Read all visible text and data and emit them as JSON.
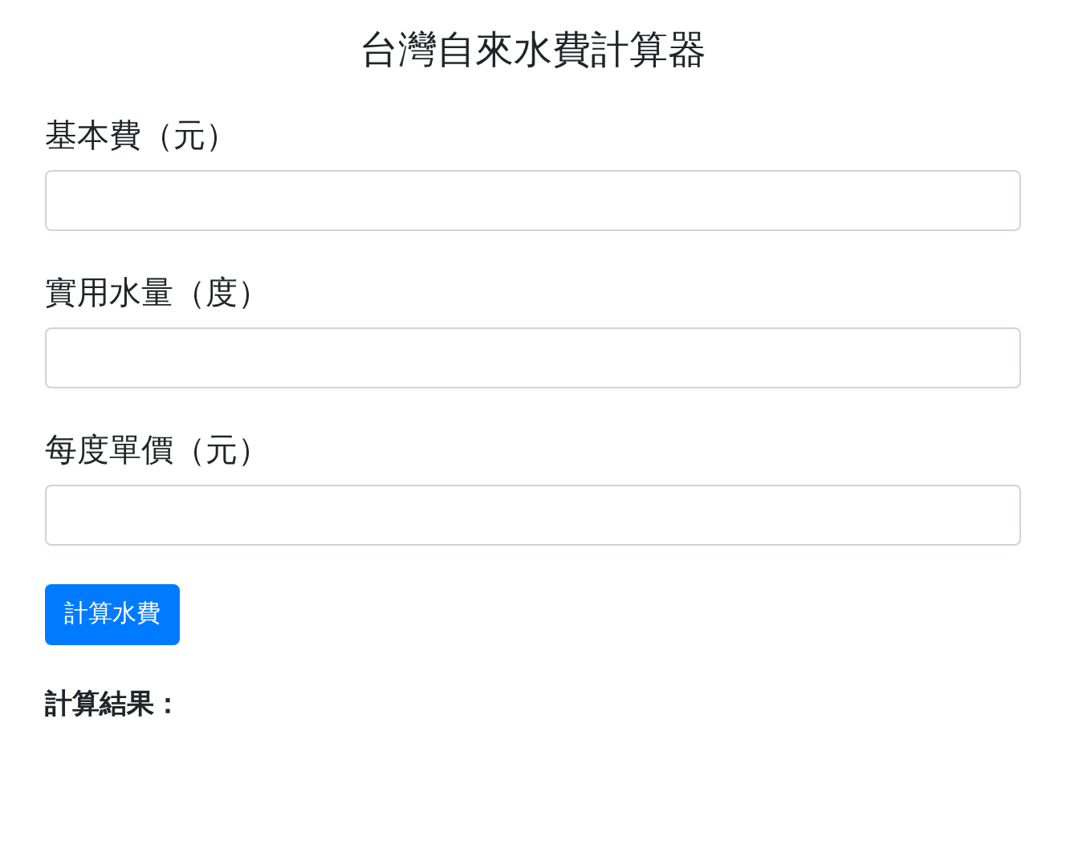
{
  "title": "台灣自來水費計算器",
  "fields": [
    {
      "label": "基本費（元）"
    },
    {
      "label": "實用水量（度）"
    },
    {
      "label": "每度單價（元）"
    }
  ],
  "button": "計算水費",
  "result_label": "計算結果："
}
